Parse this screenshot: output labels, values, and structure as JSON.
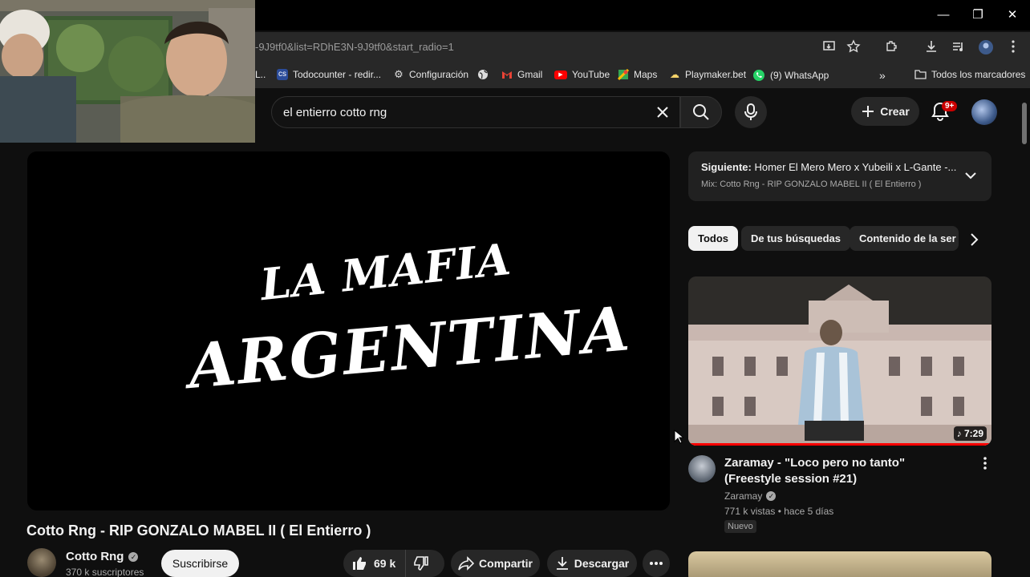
{
  "browser": {
    "url": "-9J9tf0&list=RDhE3N-9J9tf0&start_radio=1",
    "window_controls": {
      "minimize": "—",
      "restore": "❐",
      "close": "✕"
    },
    "bookmarks": [
      {
        "label": "L..",
        "icon": ""
      },
      {
        "label": "Todocounter - redir...",
        "icon": "cs"
      },
      {
        "label": "Configuración",
        "icon": "⚙"
      },
      {
        "label": "",
        "icon": "globe"
      },
      {
        "label": "Gmail",
        "icon": "M"
      },
      {
        "label": "YouTube",
        "icon": "▶"
      },
      {
        "label": "Maps",
        "icon": "map"
      },
      {
        "label": "Playmaker.bet",
        "icon": "☁"
      },
      {
        "label": "(9) WhatsApp",
        "icon": "wa"
      }
    ],
    "more_bookmarks": "»",
    "all_bookmarks": "Todos los marcadores"
  },
  "masthead": {
    "search_query": "el entierro cotto rng",
    "create_label": "Crear",
    "notification_count": "9+"
  },
  "video": {
    "title": "Cotto Rng - RIP GONZALO MABEL II ( El Entierro )",
    "logo_line1": "LA MAFIA",
    "logo_line2": "ARGENTINA",
    "channel": "Cotto Rng",
    "subscribers": "370 k suscriptores",
    "subscribe_label": "Suscribirse",
    "likes": "69 k",
    "share_label": "Compartir",
    "download_label": "Descargar"
  },
  "playlist": {
    "next_label": "Siguiente:",
    "next_title": "Homer El Mero Mero x Yubeili x L-Gante -...",
    "mix_title": "Mix: Cotto Rng - RIP GONZALO MABEL II ( El Entierro )"
  },
  "chips": [
    "Todos",
    "De tus búsquedas",
    "Contenido de la ser"
  ],
  "recommendation": {
    "title": "Zaramay - \"Loco pero no tanto\" (Freestyle session #21)",
    "channel": "Zaramay",
    "meta": "771 k vistas • hace 5 días",
    "badge": "Nuevo",
    "duration": "♪ 7:29"
  },
  "colors": {
    "background": "#0f0f0f",
    "accent_red": "#ff0000",
    "chip_active": "#f1f1f1",
    "surface": "#272727"
  }
}
